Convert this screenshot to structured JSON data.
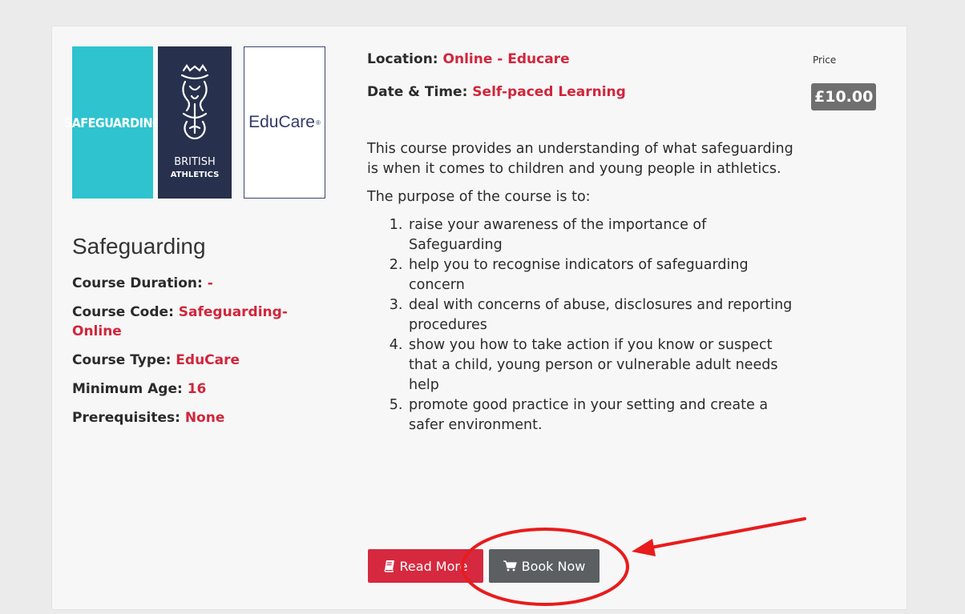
{
  "logos": {
    "safeguarding_text": "SAFEGUARDING",
    "british_athletics_line1": "BRITISH",
    "british_athletics_line2": "ATHLETICS",
    "educare_text": "EduCare",
    "educare_mark": "®"
  },
  "course": {
    "title": "Safeguarding",
    "details": [
      {
        "label": "Course Duration: ",
        "value": "-"
      },
      {
        "label": "Course Code: ",
        "value": "Safeguarding-Online"
      },
      {
        "label": "Course Type: ",
        "value": "EduCare"
      },
      {
        "label": "Minimum Age: ",
        "value": "16"
      },
      {
        "label": "Prerequisites: ",
        "value": "None"
      }
    ]
  },
  "location": {
    "label": "Location: ",
    "value": "Online - Educare"
  },
  "datetime": {
    "label": "Date & Time: ",
    "value": "Self-paced Learning"
  },
  "description": {
    "intro": "This course provides an understanding of what safeguarding is when it comes to children and young people in athletics.",
    "purpose_heading": "The purpose of the course is to:",
    "purposes": [
      "raise your awareness of the importance of Safeguarding",
      "help you to recognise indicators of safeguarding concern",
      "deal with concerns of abuse, disclosures and reporting procedures",
      "show you how to take action if you know or suspect that a child, young person or vulnerable adult needs help",
      "promote good practice in your setting and create a safer environment."
    ]
  },
  "price": {
    "label": "Price",
    "value": "£10.00"
  },
  "buttons": {
    "read_more": "Read More",
    "book_now": "Book Now"
  },
  "icons": {
    "read_more": "book-icon",
    "book_now": "shopping-cart-icon"
  },
  "colors": {
    "accent_red": "#d0263c",
    "read_more_bg": "#d6293f",
    "book_now_bg": "#5c5f62",
    "price_badge_bg": "#6f6f6f",
    "annotation_red": "#e81c1c",
    "safeguarding_logo_bg": "#2ec3cf",
    "athletics_logo_bg": "#27304c"
  }
}
